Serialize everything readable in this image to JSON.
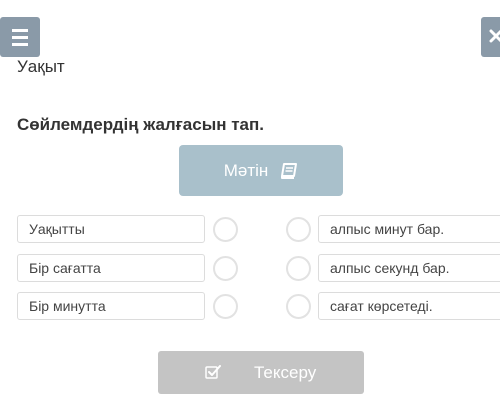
{
  "header": {
    "menu_icon": "hamburger-menu-icon",
    "close_icon": "close-icon"
  },
  "lesson": {
    "topic": "Уақыт",
    "task": "Сөйлемдердің жалғасын тап."
  },
  "text_button": {
    "label": "Мәтін",
    "icon": "book-icon"
  },
  "matching": {
    "left_items": [
      "Уақытты",
      "Бір сағатта",
      "Бір минутта"
    ],
    "right_items": [
      "алпыс минут бар.",
      "алпыс секунд бар.",
      "сағат көрсетеді."
    ]
  },
  "check_button": {
    "label": "Тексеру",
    "icon": "check-square-icon"
  },
  "colors": {
    "header_button": "#8a9aa8",
    "text_button": "#a9c0cb",
    "check_button_disabled": "#c4c4c4"
  }
}
